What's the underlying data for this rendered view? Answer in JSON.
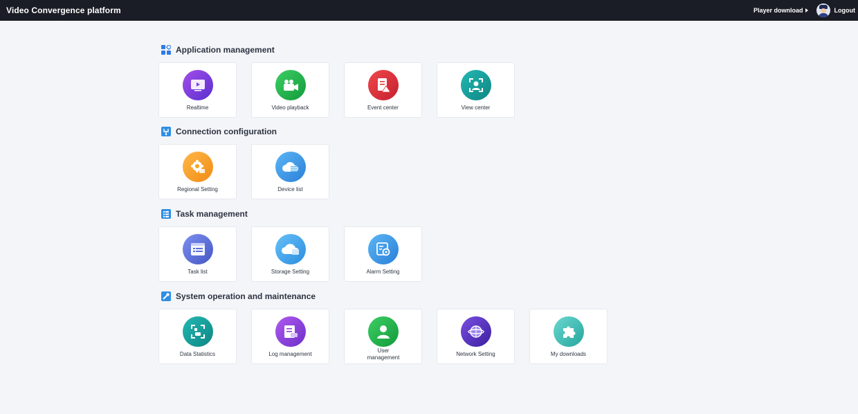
{
  "header": {
    "title": "Video Convergence platform",
    "player_download": "Player download",
    "logout": "Logout"
  },
  "sections": [
    {
      "title": "Application management",
      "items": [
        {
          "label": "Realtime",
          "icon": "play-screen-icon",
          "color": "#7b3fe4"
        },
        {
          "label": "Video playback",
          "icon": "video-camera-icon",
          "color": "#22b14c"
        },
        {
          "label": "Event center",
          "icon": "document-alert-icon",
          "color": "#e53935"
        },
        {
          "label": "View center",
          "icon": "face-scan-icon",
          "color": "#149e9c"
        }
      ]
    },
    {
      "title": "Connection configuration",
      "items": [
        {
          "label": "Regional Setting",
          "icon": "gear-icon",
          "color": "#f5a623"
        },
        {
          "label": "Device list",
          "icon": "cloud-device-icon",
          "color": "#3a9be8"
        }
      ]
    },
    {
      "title": "Task management",
      "items": [
        {
          "label": "Task list",
          "icon": "task-list-icon",
          "color": "#5b6fd6"
        },
        {
          "label": "Storage Setting",
          "icon": "cloud-storage-icon",
          "color": "#3aa6ec"
        },
        {
          "label": "Alarm Setting",
          "icon": "alarm-settings-icon",
          "color": "#3a9be8"
        }
      ]
    },
    {
      "title": "System operation and maintenance",
      "items": [
        {
          "label": "Data Statistics",
          "icon": "data-statistics-icon",
          "color": "#149e9c"
        },
        {
          "label": "Log management",
          "icon": "log-document-icon",
          "color": "#8e3fd8"
        },
        {
          "label": "User management",
          "icon": "user-icon",
          "color": "#22b14c"
        },
        {
          "label": "Network Setting",
          "icon": "network-globe-icon",
          "color": "#5a2fc4"
        },
        {
          "label": "My downloads",
          "icon": "puzzle-icon",
          "color": "#3ec1b8"
        }
      ]
    }
  ]
}
